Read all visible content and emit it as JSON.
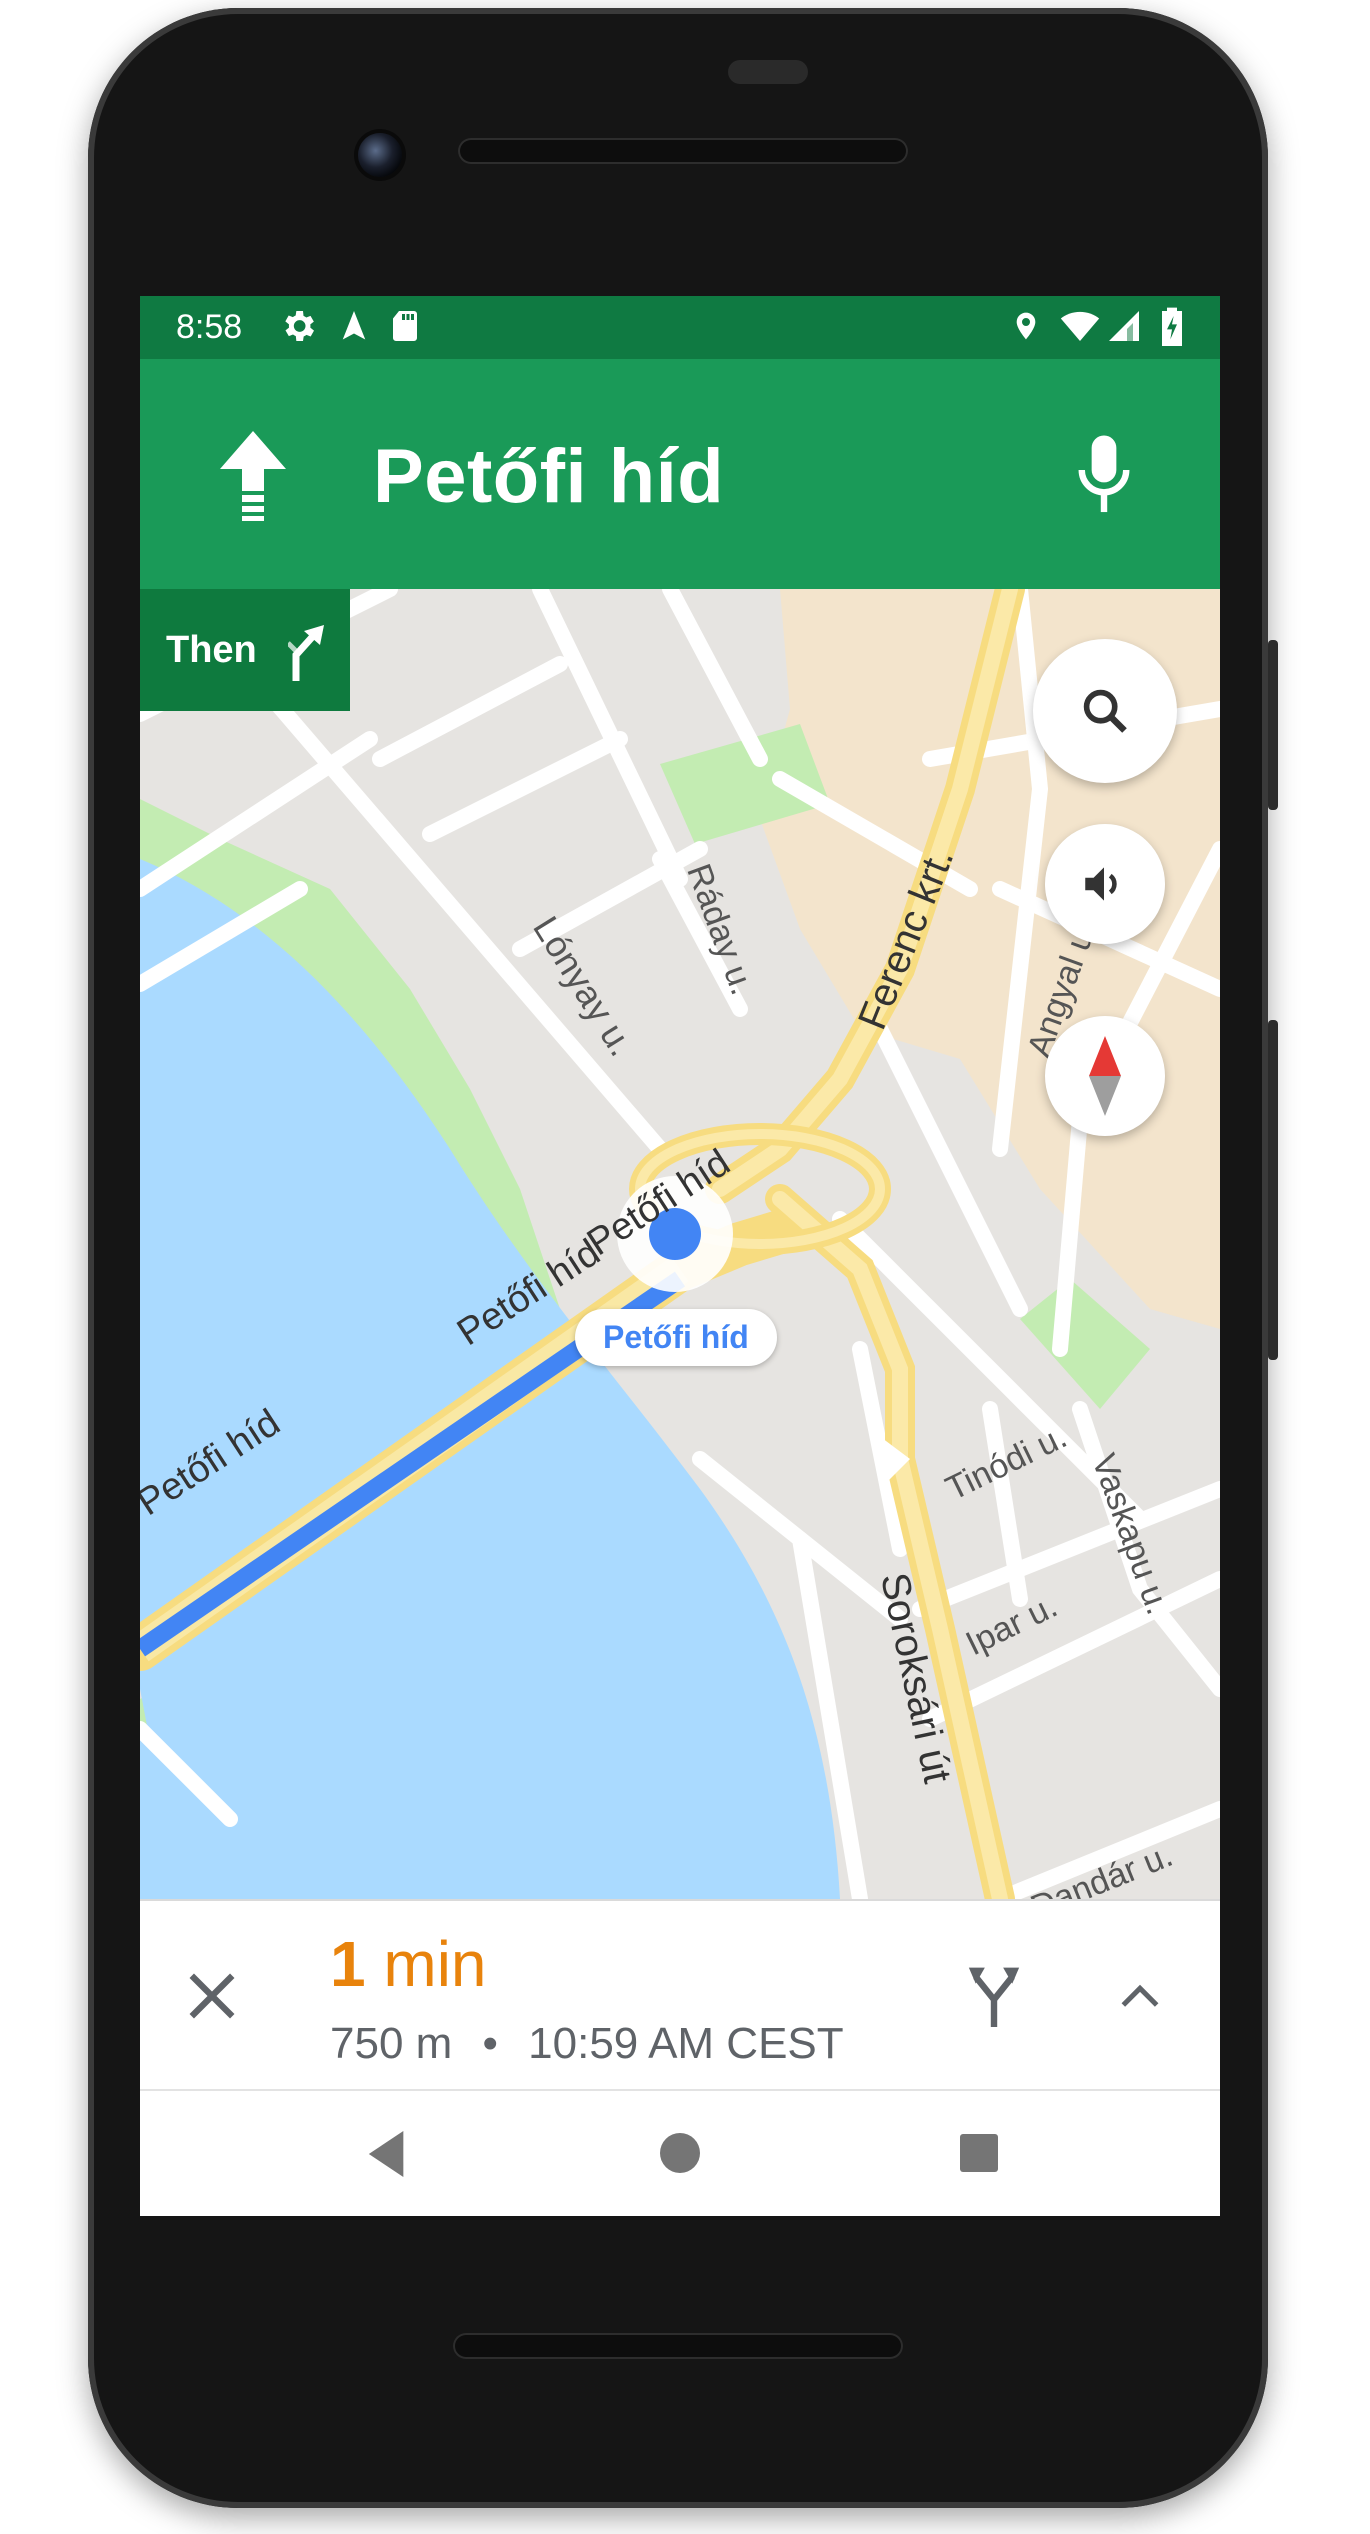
{
  "status_bar": {
    "time": "8:58"
  },
  "nav_header": {
    "street": "Petőfi híd",
    "maneuver": "straight"
  },
  "then_chip": {
    "label": "Then"
  },
  "map": {
    "street_labels": {
      "petofi_hid_1": "Petőfi híd",
      "petofi_hid_2": "Petőfi híd",
      "petofi_hid_3": "Petőfi híd",
      "lonyay": "Lónyay u.",
      "raday": "Ráday u.",
      "ferenc": "Ferenc krt.",
      "angyal": "Angyal u.",
      "tinodi": "Tinódi u.",
      "vaskapu": "Vaskapu u.",
      "ipar": "Ipar u.",
      "soroksari": "Soroksári út",
      "dandar": "Dandár u."
    },
    "location_label": "Petőfi híd"
  },
  "trip": {
    "minutes": "1",
    "unit": "min",
    "distance": "750 m",
    "separator": "•",
    "arrival": "10:59 AM CEST"
  },
  "colors": {
    "header_green": "#1a9a58",
    "status_green": "#0f7a42",
    "eta_orange": "#e8830c",
    "route_blue": "#4285f4",
    "water": "#aadaff",
    "park": "#c3ecb2"
  }
}
